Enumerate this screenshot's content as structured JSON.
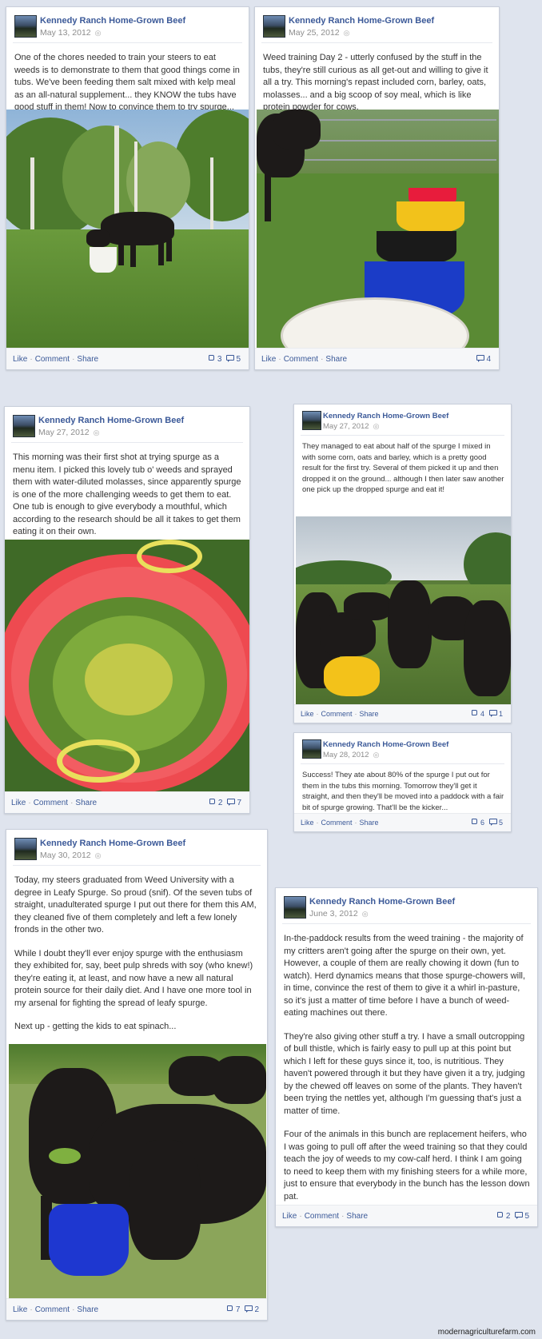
{
  "page_name": "Kennedy Ranch Home-Grown Beef",
  "actions": {
    "like": "Like",
    "comment": "Comment",
    "share": "Share",
    "separator": "·"
  },
  "posts": [
    {
      "date": "May 13, 2012",
      "paragraphs": [
        "One of the chores needed to train your steers to eat weeds is to demonstrate to them that good things come in tubs. We've been feeding them salt mixed with kelp meal as an all-natural supplement... they KNOW the tubs have good stuff in them! Now to convince them to try spurge..."
      ],
      "likes": "3",
      "comments": "5"
    },
    {
      "date": "May 25, 2012",
      "paragraphs": [
        "Weed training Day 2 - utterly confused by the stuff in the tubs, they're still curious as all get-out and willing to give it all a try. This morning's repast included corn, barley, oats, molasses... and a big scoop of soy meal, which is like protein powder for cows."
      ],
      "likes": "",
      "comments": "4"
    },
    {
      "date": "May 27, 2012",
      "paragraphs": [
        "This morning was their first shot at trying spurge as a menu item. I picked this lovely tub o' weeds and sprayed them with water-diluted molasses, since apparently spurge is one of the more challenging weeds to get them to eat. One tub is enough to give everybody a mouthful, which according to the research should be all it takes to get them eating it on their own."
      ],
      "likes": "2",
      "comments": "7"
    },
    {
      "date": "May 27, 2012",
      "paragraphs": [
        "They managed to eat about half of the spurge I mixed in with some corn, oats and barley, which is a pretty good result for the first try. Several of them picked it up and then dropped it on the ground... although I then later saw another one pick up the dropped spurge and eat it!"
      ],
      "likes": "4",
      "comments": "1"
    },
    {
      "date": "May 28, 2012",
      "paragraphs": [
        "Success! They ate about 80% of the spurge I put out for them in the tubs this morning. Tomorrow they'll get it straight, and then they'll be moved into a paddock with a fair bit of spurge growing. That'll be the kicker..."
      ],
      "likes": "6",
      "comments": "5"
    },
    {
      "date": "May 30, 2012",
      "paragraphs": [
        "Today, my steers graduated from Weed University with a degree in Leafy Spurge. So proud (snif). Of the seven tubs of straight, unadulterated spurge I put out there for them this AM, they cleaned five of them completely and left a few lonely fronds in the other two.",
        "While I doubt they'll ever enjoy spurge with the enthusiasm they exhibited for, say, beet pulp shreds with soy (who knew!) they're eating it, at least, and now have a new all natural protein source for their daily diet. And I have one more tool in my arsenal for fighting the spread of leafy spurge.",
        "Next up - getting the kids to eat spinach..."
      ],
      "likes": "7",
      "comments": "2"
    },
    {
      "date": "June 3, 2012",
      "paragraphs": [
        "In-the-paddock results from the weed training - the majority of my critters aren't going after the spurge on their own, yet. However, a couple of them are really chowing it down (fun to watch). Herd dynamics means that those spurge-chowers will, in time, convince the rest of them to give it a whirl in-pasture, so it's just a matter of time before I have a bunch of weed-eating machines out there.",
        "They're also giving other stuff a try. I have a small outcropping of bull thistle, which is fairly easy to pull up at this point but which I left for these guys since it, too, is nutritious. They haven't powered through it but they have given it a try, judging by the chewed off leaves on some of the plants. They haven't been trying the nettles yet, although I'm guessing that's just a matter of time.",
        "Four of the animals in this bunch are replacement heifers, who I was going to pull off after the weed training so that they could teach the joy of weeds to my cow-calf herd. I think I am going to need to keep them with my finishing steers for a while more, just to ensure that everybody in the bunch has the lesson down pat."
      ],
      "likes": "2",
      "comments": "5"
    }
  ],
  "watermark": "modernagriculturefarm.com"
}
